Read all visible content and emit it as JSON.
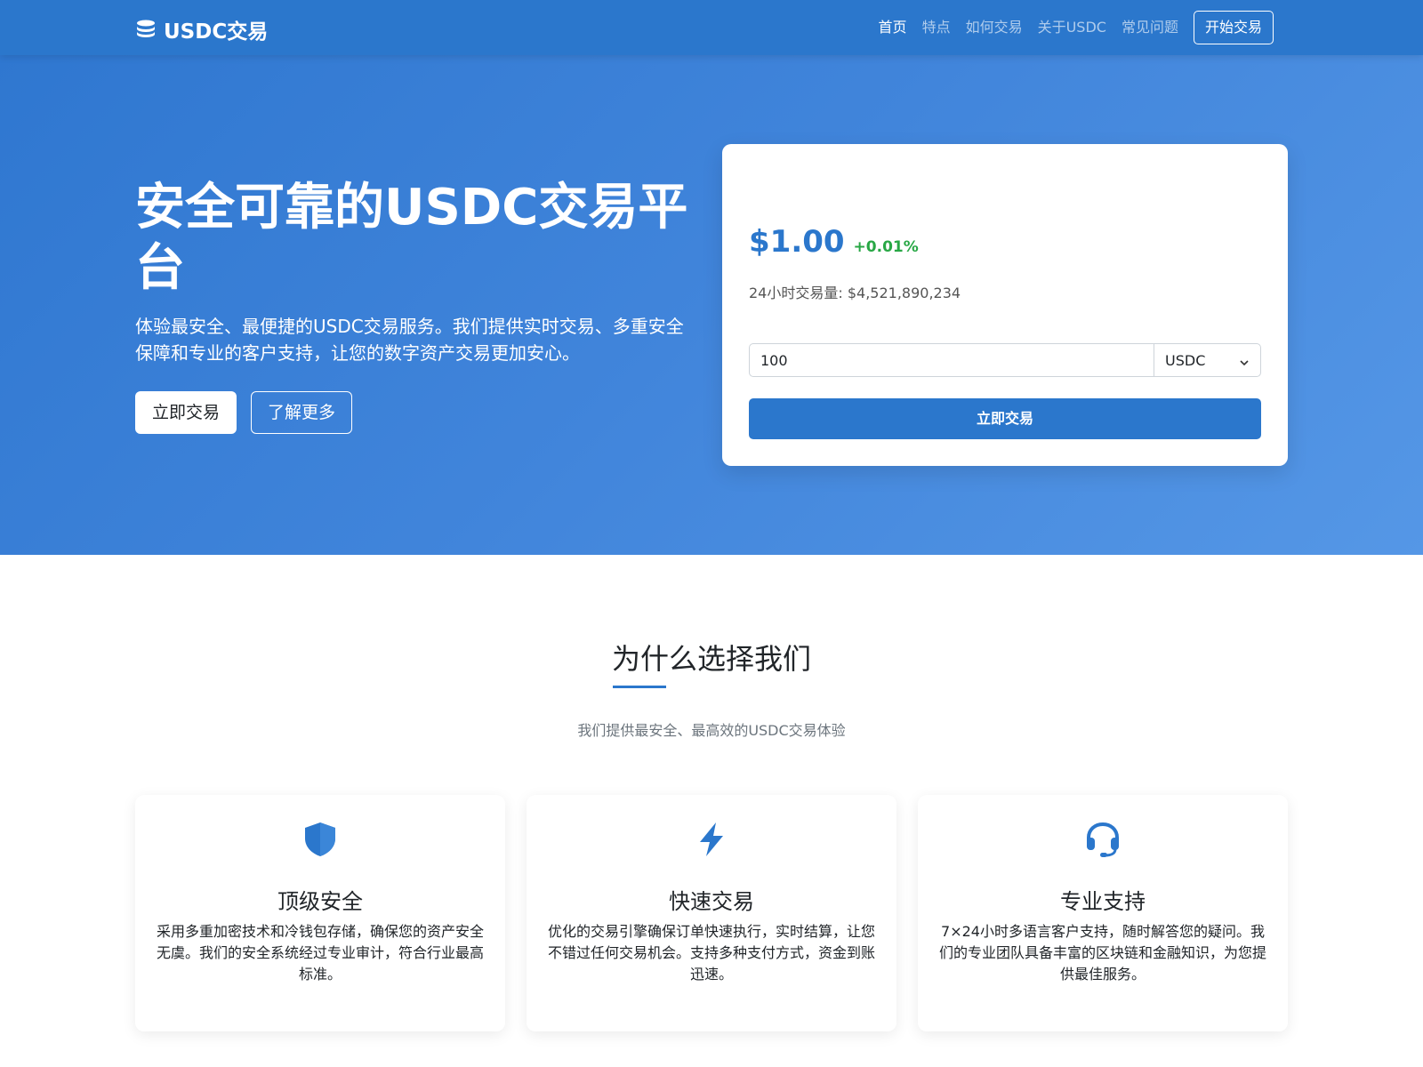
{
  "nav": {
    "brand": "USDC交易",
    "links": [
      "首页",
      "特点",
      "如何交易",
      "关于USDC",
      "常见问题"
    ],
    "cta": "开始交易"
  },
  "hero": {
    "title": "安全可靠的USDC交易平台",
    "description": "体验最安全、最便捷的USDC交易服务。我们提供实时交易、多重安全保障和专业的客户支持，让您的数字资产交易更加安心。",
    "primary_button": "立即交易",
    "secondary_button": "了解更多"
  },
  "trade": {
    "price": "$1.00",
    "change": "+0.01%",
    "volume": "24小时交易量: $4,521,890,234",
    "amount": "100",
    "currency": "USDC",
    "button": "立即交易"
  },
  "features": {
    "title": "为什么选择我们",
    "subtitle": "我们提供最安全、最高效的USDC交易体验",
    "items": [
      {
        "icon": "shield-icon",
        "title": "顶级安全",
        "text": "采用多重加密技术和冷钱包存储，确保您的资产安全无虞。我们的安全系统经过专业审计，符合行业最高标准。"
      },
      {
        "icon": "bolt-icon",
        "title": "快速交易",
        "text": "优化的交易引擎确保订单快速执行，实时结算，让您不错过任何交易机会。支持多种支付方式，资金到账迅速。"
      },
      {
        "icon": "headset-icon",
        "title": "专业支持",
        "text": "7×24小时多语言客户支持，随时解答您的疑问。我们的专业团队具备丰富的区块链和金融知识，为您提供最佳服务。"
      }
    ]
  },
  "colors": {
    "primary": "#2b77cc",
    "positive": "#28a745"
  }
}
